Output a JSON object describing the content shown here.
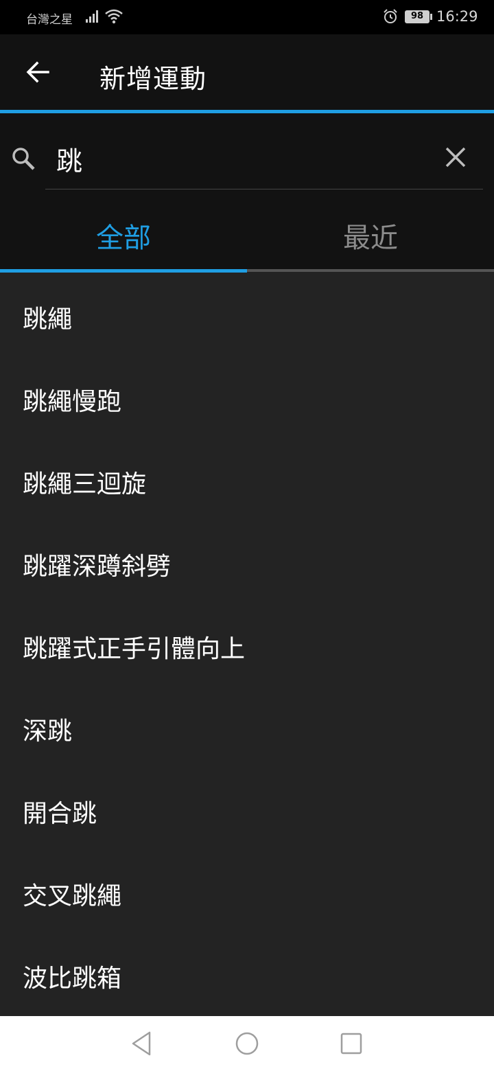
{
  "status_bar": {
    "carrier": "台灣之星",
    "battery": "98",
    "time": "16:29"
  },
  "app_bar": {
    "title": "新增運動"
  },
  "search": {
    "value": "跳"
  },
  "tabs": [
    {
      "label": "全部",
      "active": true
    },
    {
      "label": "最近",
      "active": false
    }
  ],
  "exercises": [
    "跳繩",
    "跳繩慢跑",
    "跳繩三迴旋",
    "跳躍深蹲斜劈",
    "跳躍式正手引體向上",
    "深跳",
    "開合跳",
    "交叉跳繩",
    "波比跳箱"
  ],
  "colors": {
    "accent": "#1f9ee3",
    "background": "#232323",
    "header": "#121212"
  }
}
